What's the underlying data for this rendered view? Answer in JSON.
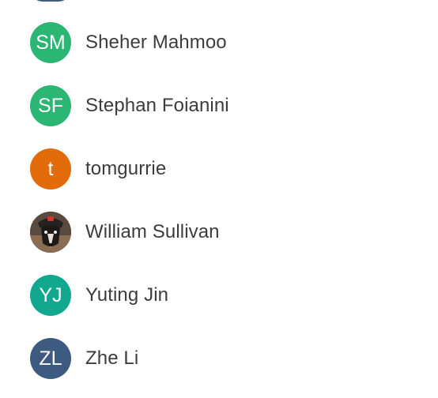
{
  "colors": {
    "green": "#2bb673",
    "orange": "#e26b0a",
    "teal": "#12a890",
    "navy": "#3d5a80",
    "text": "#3c3c3c"
  },
  "members": [
    {
      "initials": "SM",
      "name": "Sheher Mahmoo",
      "color": "#2bb673"
    },
    {
      "initials": "SF",
      "name": "Stephan Foianini",
      "color": "#2bb673"
    },
    {
      "initials": "t",
      "name": "tomgurrie",
      "color": "#e26b0a"
    },
    {
      "initials": "",
      "name": "William Sullivan",
      "avatar": "photo"
    },
    {
      "initials": "YJ",
      "name": "Yuting Jin",
      "color": "#12a890"
    },
    {
      "initials": "ZL",
      "name": "Zhe Li",
      "color": "#3d5a80"
    }
  ]
}
